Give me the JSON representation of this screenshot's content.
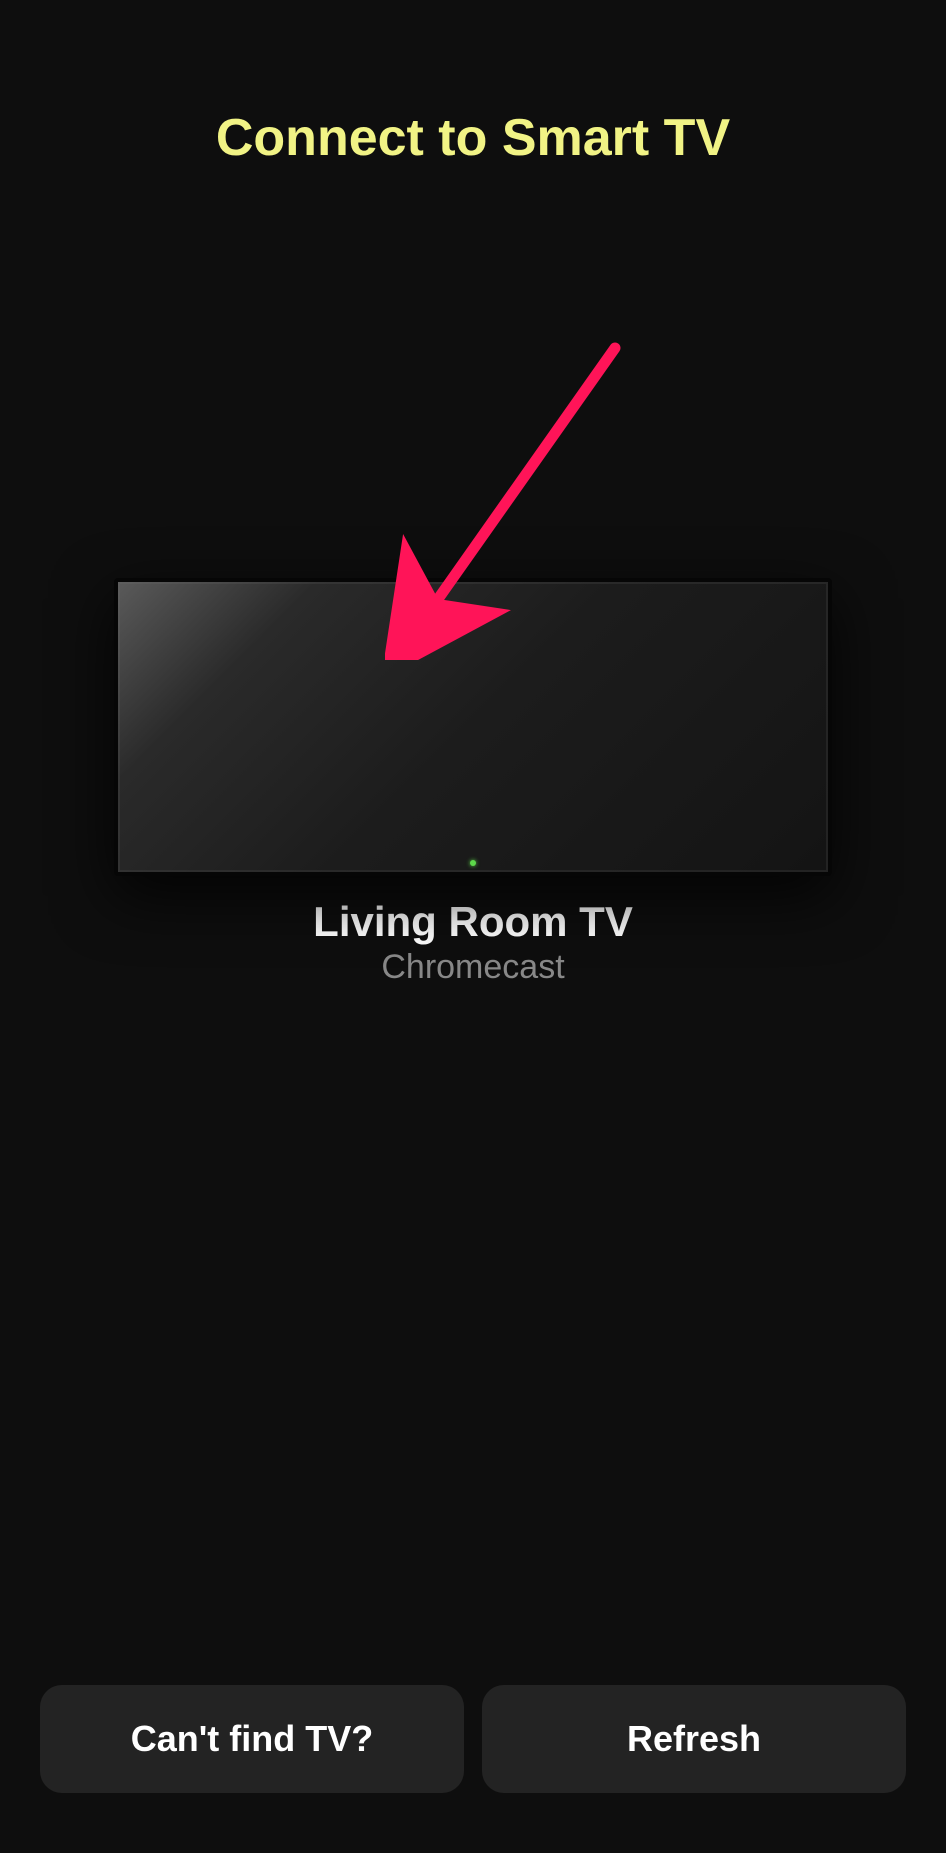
{
  "header": {
    "title": "Connect to Smart TV"
  },
  "device": {
    "name": "Living Room TV",
    "type": "Chromecast"
  },
  "buttons": {
    "cant_find_label": "Can't find TV?",
    "refresh_label": "Refresh"
  }
}
